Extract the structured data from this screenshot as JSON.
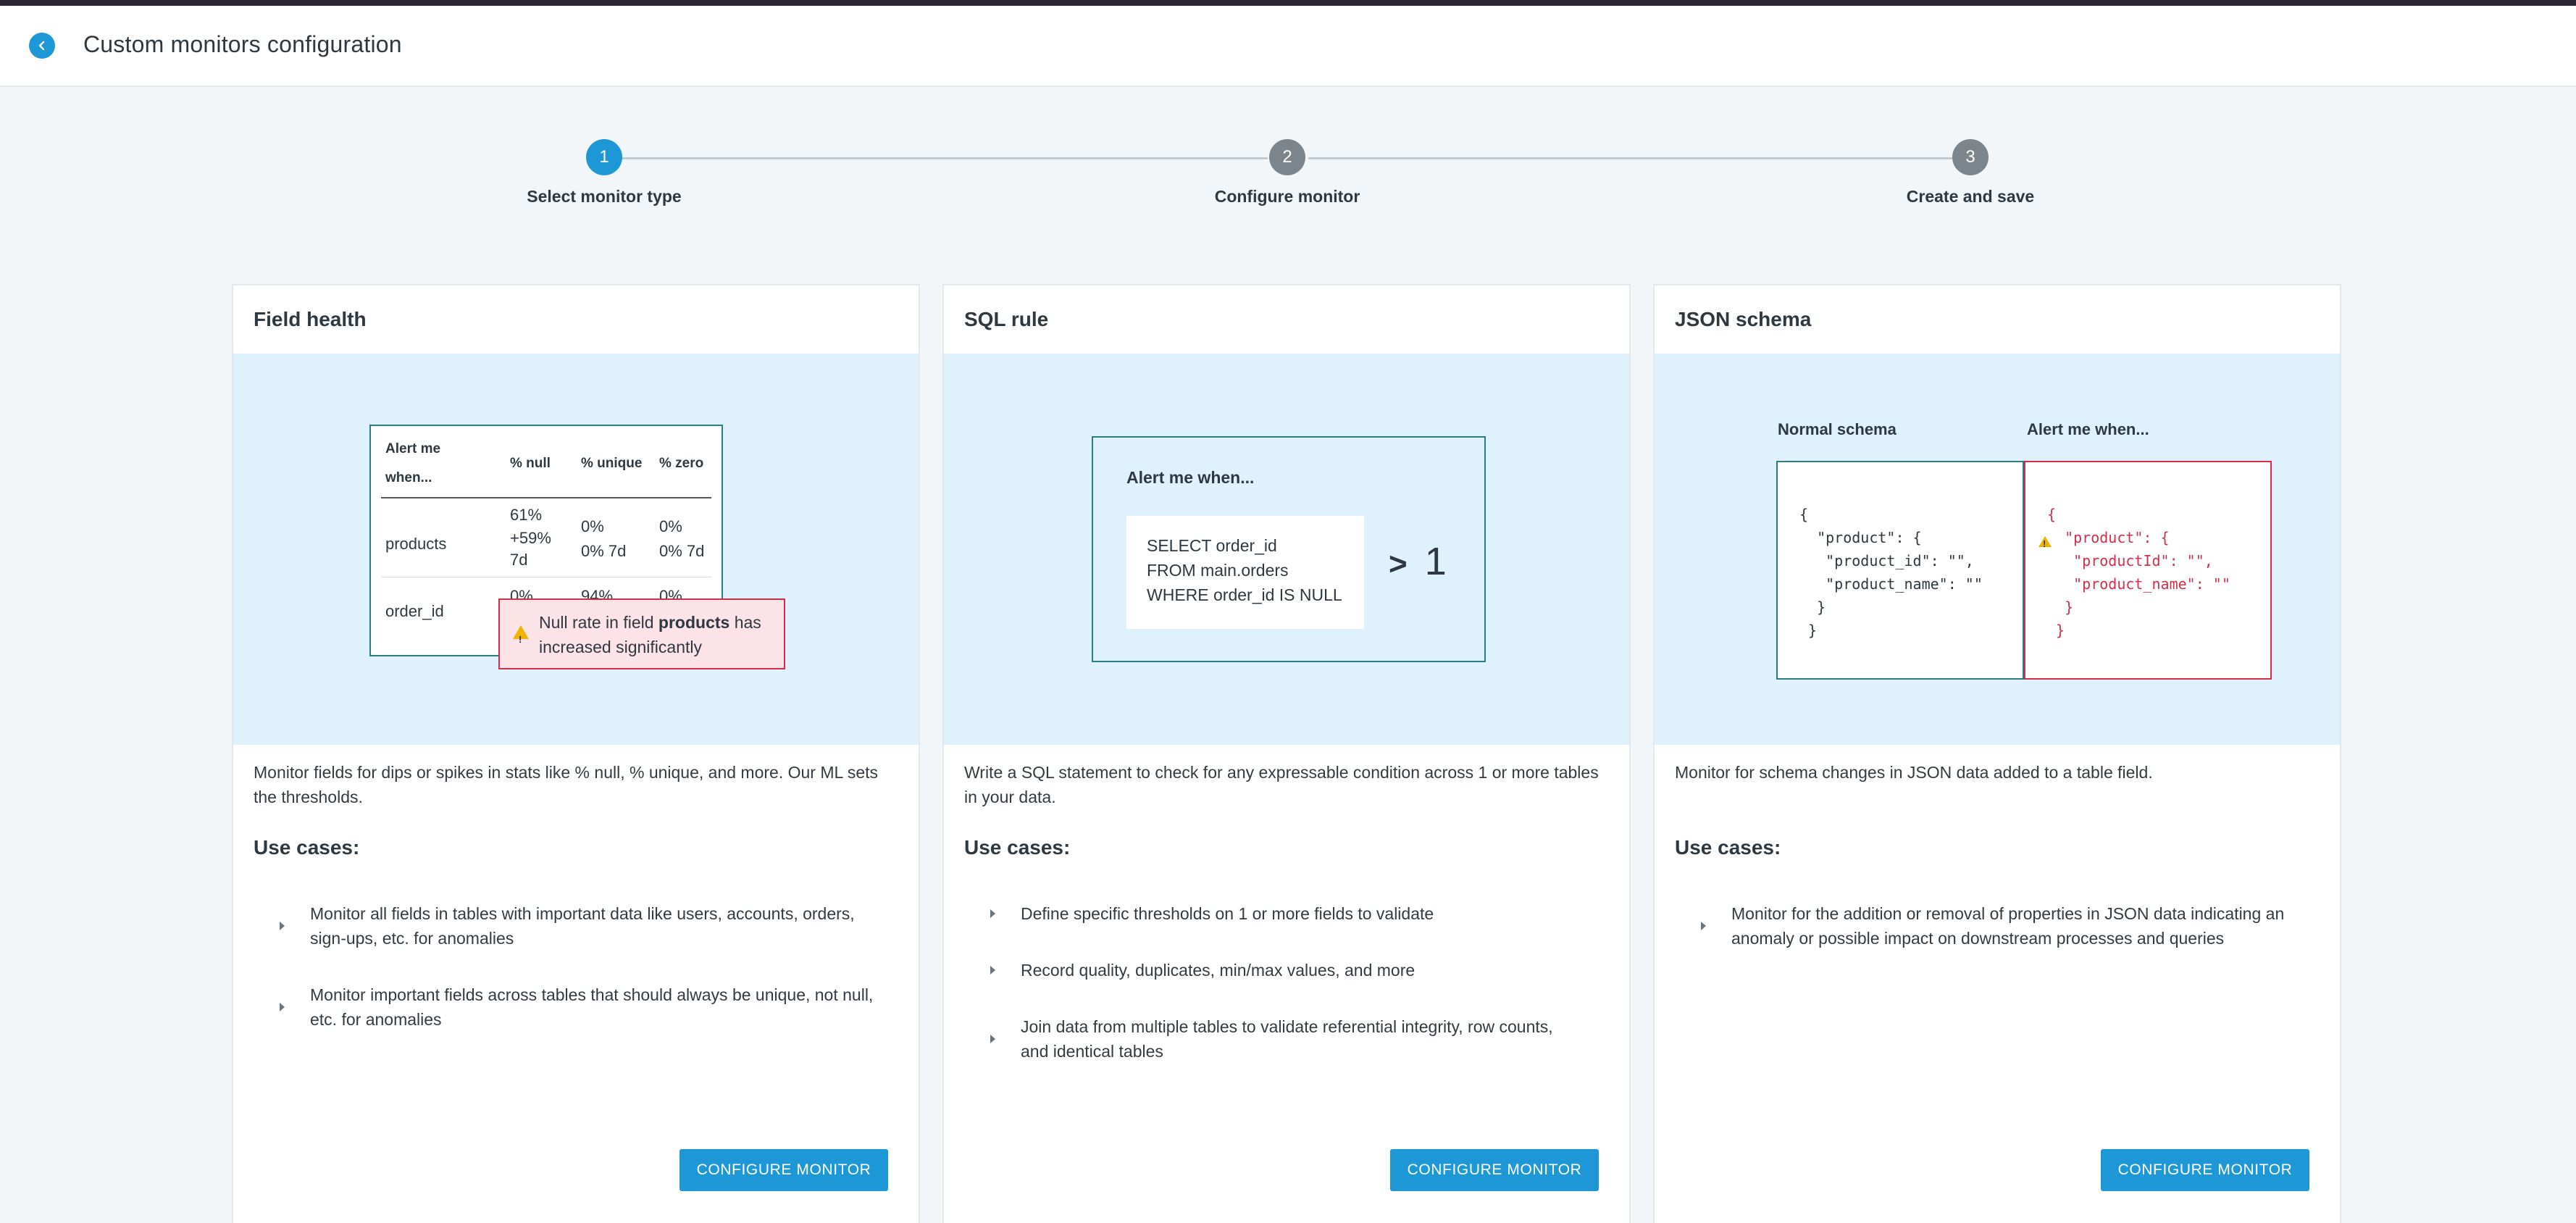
{
  "header": {
    "title": "Custom monitors configuration",
    "back_icon": "chevron-left-icon",
    "accent": "#1d97d6"
  },
  "stepper": {
    "steps": [
      {
        "number": "1",
        "label": "Select monitor type",
        "state": "active"
      },
      {
        "number": "2",
        "label": "Configure monitor",
        "state": "inactive"
      },
      {
        "number": "3",
        "label": "Create and save",
        "state": "inactive"
      }
    ]
  },
  "cards": [
    {
      "title": "Field health",
      "illustration": {
        "headers": [
          "Alert me when...",
          "% null",
          "% unique",
          "% zero"
        ],
        "rows": [
          {
            "field": "products",
            "null": "61%",
            "null_change": "+59%",
            "null_period": "7d",
            "unique": "0%",
            "unique_sub": "0% 7d",
            "zero": "0%",
            "zero_sub": "0% 7d"
          },
          {
            "field": "order_id",
            "null": "0%",
            "unique": "94%",
            "zero": "0%"
          }
        ],
        "alert_prefix": "Null rate in field ",
        "alert_field": "products",
        "alert_suffix": " has increased significantly"
      },
      "description": "Monitor fields for dips or spikes in stats like % null, % unique, and more. Our ML sets the thresholds.",
      "use_cases_title": "Use cases:",
      "use_cases": [
        "Monitor all fields in tables with important data like users, accounts, orders, sign-ups, etc. for anomalies",
        "Monitor important fields across tables that should always be unique, not null, etc. for anomalies"
      ],
      "button": "CONFIGURE MONITOR"
    },
    {
      "title": "SQL rule",
      "illustration": {
        "label": "Alert me when...",
        "sql_lines": [
          "SELECT order_id",
          "FROM main.orders",
          "WHERE order_id IS NULL"
        ],
        "operator": ">",
        "threshold": "1"
      },
      "description": "Write a SQL statement to check for any expressable condition across 1 or more tables in your data.",
      "use_cases_title": "Use cases:",
      "use_cases": [
        "Define specific thresholds on 1 or more fields to validate",
        "Record quality, duplicates, min/max values, and more",
        "Join data from multiple tables to validate referential integrity, row counts, and identical tables"
      ],
      "button": "CONFIGURE MONITOR"
    },
    {
      "title": "JSON schema",
      "illustration": {
        "normal_label": "Normal schema",
        "alert_label": "Alert me when...",
        "normal_code": "{\n  \"product\": {\n   \"product_id\": \"\",\n   \"product_name\": \"\"\n  }\n }",
        "alert_code": "{\n  \"product\": {\n   \"productId\": \"\",\n   \"product_name\": \"\"\n  }\n }"
      },
      "description": "Monitor for schema changes in JSON data added to a table field.",
      "use_cases_title": "Use cases:",
      "use_cases": [
        "Monitor for the addition or removal of properties in JSON data indicating an anomaly or possible impact on downstream processes and queries"
      ],
      "button": "CONFIGURE MONITOR"
    }
  ]
}
